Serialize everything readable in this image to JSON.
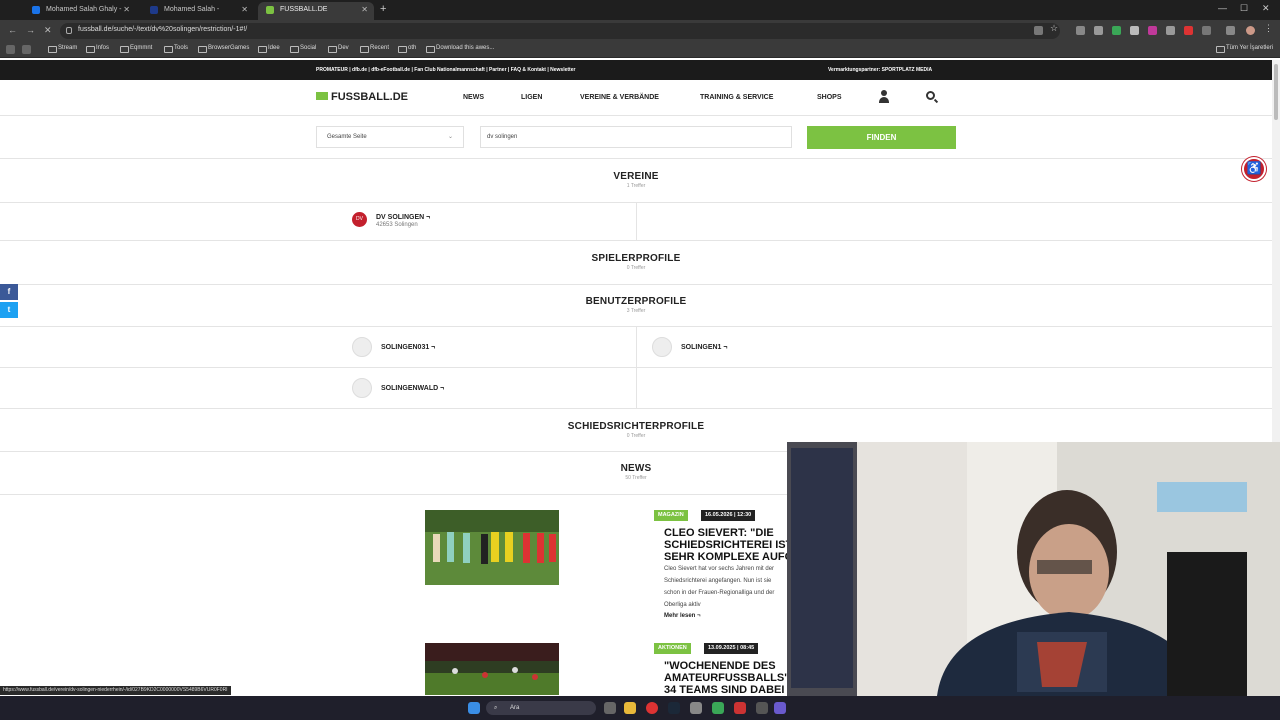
{
  "browser": {
    "tabs": [
      {
        "label": "Mohamed Salah Ghaly - İstatis",
        "color": "#1a73e8"
      },
      {
        "label": "Mohamed Salah - Spielerprofil",
        "color": "#1e3a8a"
      },
      {
        "label": "FUSSBALL.DE",
        "color": "#7cc242"
      }
    ],
    "new_tab": "+",
    "url": "fussball.de/suche/-/text/dv%20solingen/restriction/-1#!/",
    "bookmarks": [
      "Stream",
      "Infos",
      "Eqmmnt",
      "Tools",
      "BrowserGames",
      "Idee",
      "Social",
      "Dev",
      "Recent",
      "oth",
      "Download this awes..."
    ],
    "all_bookmarks": "Tüm Yer İşaretleri"
  },
  "site": {
    "promo_left": "PROMATEUR | dfb.de | dfb-eFootball.de | Fan Club Nationalmannschaft | Partner | FAQ & Kontakt | Newsletter",
    "promo_right": "Vermarktungspartner: SPORTPLATZ MEDIA",
    "logo": "FUSSBALL.DE",
    "nav": [
      "NEWS",
      "LIGEN",
      "VEREINE & VERBÄNDE",
      "TRAINING & SERVICE",
      "SHOPS"
    ],
    "search": {
      "scope": "Gesamte Seite",
      "query": "dv solingen",
      "button": "FINDEN"
    }
  },
  "results": {
    "vereine": {
      "title": "VEREINE",
      "count": "1 Treffer",
      "items": [
        {
          "name": "DV SOLINGEN ¬",
          "sub": "42653 Solingen",
          "crest": "DV"
        }
      ]
    },
    "spielerprofile": {
      "title": "SPIELERPROFILE",
      "count": "0 Treffer"
    },
    "benutzerprofile": {
      "title": "BENUTZERPROFILE",
      "count": "3 Treffer",
      "items": [
        "SOLINGEN031 ¬",
        "SOLINGEN1 ¬",
        "SOLINGENWALD ¬"
      ]
    },
    "schiedsrichter": {
      "title": "SCHIEDSRICHTERPROFILE",
      "count": "0 Treffer"
    },
    "news": {
      "title": "NEWS",
      "count": "50 Treffer",
      "items": [
        {
          "category": "MAGAZIN",
          "date": "16.05.2026 | 12:30",
          "title_lines": [
            "CLEO SIEVERT: \"DIE",
            "SCHIEDSRICHTEREI IST",
            "SEHR KOMPLEXE AUFGABE\""
          ],
          "teaser": "Cleo Sievert hat vor sechs Jahren mit der Schiedsrichterei angefangen. Nun ist sie schon in der Frauen-Regionalliga und der Oberliga aktiv",
          "more": "Mehr lesen ¬"
        },
        {
          "category": "AKTIONEN",
          "date": "13.09.2025 | 08:45",
          "title_lines": [
            "\"WOCHENENDE DES",
            "AMATEURFUSSBALLS\":",
            "34 TEAMS SIND DABEI"
          ]
        }
      ]
    }
  },
  "status_url": "https://www.fussball.de/verein/dv-solingen-niederrhein/-/id/027B9KD2C0000000VS5489B6VUR0F0RI",
  "taskbar": {
    "search": "Ara"
  },
  "colors": {
    "accent": "#7cc242",
    "crest": "#c3202d",
    "facebook": "#3b5998",
    "twitter": "#1da1f2"
  }
}
